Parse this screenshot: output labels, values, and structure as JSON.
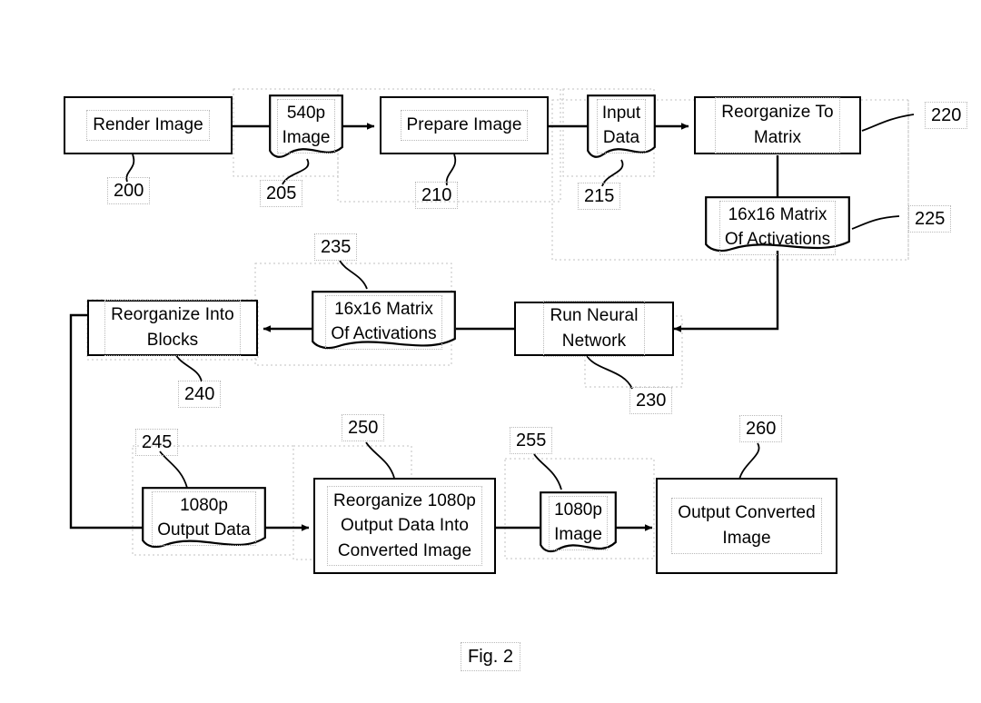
{
  "figure": {
    "caption": "Fig. 2",
    "title": "Fig. 2"
  },
  "nodes": {
    "render_image": {
      "label": "Render Image",
      "ref": "200",
      "kind": "process"
    },
    "image_540p": {
      "label": "540p\nImage",
      "ref": "205",
      "kind": "data"
    },
    "prepare_image": {
      "label": "Prepare Image",
      "ref": "210",
      "kind": "process"
    },
    "input_data": {
      "label": "Input\nData",
      "ref": "215",
      "kind": "data"
    },
    "reorganize_to_matrix": {
      "label": "Reorganize To\nMatrix",
      "ref": "220",
      "kind": "process"
    },
    "matrix_activations_in": {
      "label": "16x16 Matrix\nOf Activations",
      "ref": "225",
      "kind": "data"
    },
    "run_neural_network": {
      "label": "Run Neural\nNetwork",
      "ref": "230",
      "kind": "process"
    },
    "matrix_activations_out": {
      "label": "16x16 Matrix\nOf Activations",
      "ref": "235",
      "kind": "data"
    },
    "reorganize_into_blocks": {
      "label": "Reorganize Into\nBlocks",
      "ref": "240",
      "kind": "process"
    },
    "output_data_1080p": {
      "label": "1080p\nOutput Data",
      "ref": "245",
      "kind": "data"
    },
    "reorganize_output": {
      "label": "Reorganize 1080p\nOutput Data Into\nConverted Image",
      "ref": "250",
      "kind": "process"
    },
    "image_1080p": {
      "label": "1080p\nImage",
      "ref": "255",
      "kind": "data"
    },
    "output_converted_image": {
      "label": "Output Converted\nImage",
      "ref": "260",
      "kind": "process"
    }
  },
  "flow": [
    {
      "from": "render_image",
      "to": "image_540p"
    },
    {
      "from": "image_540p",
      "to": "prepare_image"
    },
    {
      "from": "prepare_image",
      "to": "input_data"
    },
    {
      "from": "input_data",
      "to": "reorganize_to_matrix"
    },
    {
      "from": "reorganize_to_matrix",
      "to": "matrix_activations_in"
    },
    {
      "from": "matrix_activations_in",
      "to": "run_neural_network"
    },
    {
      "from": "run_neural_network",
      "to": "matrix_activations_out"
    },
    {
      "from": "matrix_activations_out",
      "to": "reorganize_into_blocks"
    },
    {
      "from": "reorganize_into_blocks",
      "to": "output_data_1080p"
    },
    {
      "from": "output_data_1080p",
      "to": "reorganize_output"
    },
    {
      "from": "reorganize_output",
      "to": "image_1080p"
    },
    {
      "from": "image_1080p",
      "to": "output_converted_image"
    }
  ],
  "style": {
    "stroke": "#000000",
    "background": "#ffffff",
    "guide": "#b9b9b9"
  }
}
